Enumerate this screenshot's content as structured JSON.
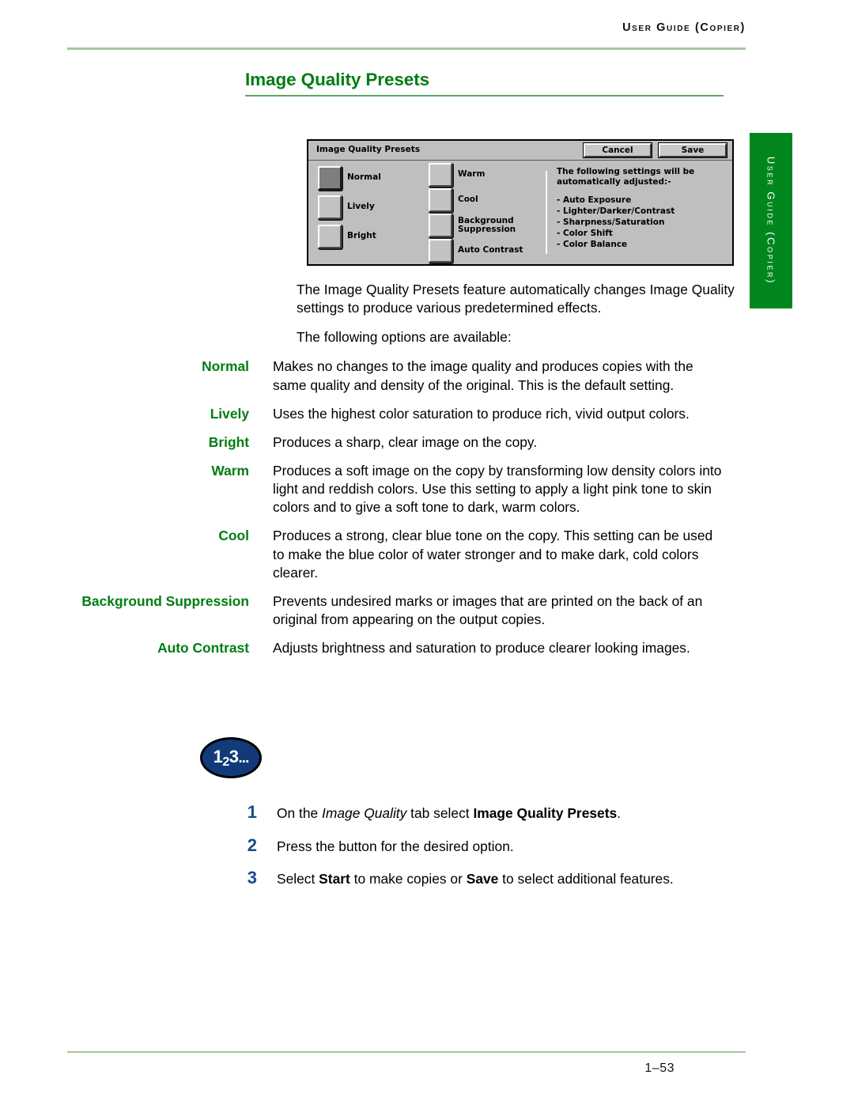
{
  "header": {
    "running_head": "User Guide (Copier)",
    "rule_color": "#a8c6a0"
  },
  "page_title": "Image Quality Presets",
  "side_tab": {
    "label": "User Guide (Copier)",
    "background": "#00861c",
    "text_color": "#ffffff"
  },
  "ui_panel": {
    "title": "Image Quality Presets",
    "cancel_label": "Cancel",
    "save_label": "Save",
    "left_options": [
      {
        "label": "Normal",
        "selected": true
      },
      {
        "label": "Lively",
        "selected": false
      },
      {
        "label": "Bright",
        "selected": false
      }
    ],
    "mid_options": [
      {
        "label": "Warm",
        "selected": false
      },
      {
        "label": "Cool",
        "selected": false
      },
      {
        "label": "Background\nSuppression",
        "selected": false
      },
      {
        "label": "Auto Contrast",
        "selected": false
      }
    ],
    "info_heading": "The following settings will be\nautomatically adjusted:-",
    "info_items": [
      "- Auto Exposure",
      "- Lighter/Darker/Contrast",
      "- Sharpness/Saturation",
      "- Color Shift",
      "- Color Balance"
    ]
  },
  "body": {
    "intro_1": "The Image Quality Presets feature automatically changes Image Quality settings to produce various predetermined effects.",
    "intro_2": "The following options are available:",
    "definitions": [
      {
        "term": "Normal",
        "description": "Makes no changes to the image quality and produces copies with the same quality and density of the original.  This is the default setting."
      },
      {
        "term": "Lively",
        "description": "Uses the highest color saturation to produce rich, vivid output colors."
      },
      {
        "term": "Bright",
        "description": "Produces a sharp, clear image on the copy."
      },
      {
        "term": "Warm",
        "description": "Produces a soft image on the copy by transforming low density colors into light and reddish colors.  Use this setting to apply a light pink tone to skin colors and to give a soft tone to dark, warm colors."
      },
      {
        "term": "Cool",
        "description": "Produces a strong, clear blue tone on the copy.  This setting can be used to make the blue color of water stronger and to make dark, cold colors clearer."
      },
      {
        "term": "Background Suppression",
        "description": "Prevents undesired marks or images that are printed on the back of an original from appearing on the output copies."
      },
      {
        "term": "Auto Contrast",
        "description": "Adjusts brightness and saturation to produce clearer looking images."
      }
    ]
  },
  "steps_badge": {
    "first": "1",
    "second": "2",
    "third": "3",
    "dots": "...",
    "fill_color": "#123a7a"
  },
  "steps": [
    {
      "number": "1",
      "text_parts": [
        {
          "text": "On the ",
          "style": "normal"
        },
        {
          "text": "Image Quality",
          "style": "italic"
        },
        {
          "text": " tab select ",
          "style": "normal"
        },
        {
          "text": "Image Quality Presets",
          "style": "bold"
        },
        {
          "text": ".",
          "style": "normal"
        }
      ]
    },
    {
      "number": "2",
      "text_parts": [
        {
          "text": "Press the button for the desired option.",
          "style": "normal"
        }
      ]
    },
    {
      "number": "3",
      "text_parts": [
        {
          "text": "Select ",
          "style": "normal"
        },
        {
          "text": "Start",
          "style": "bold"
        },
        {
          "text": " to make copies or ",
          "style": "normal"
        },
        {
          "text": "Save",
          "style": "bold"
        },
        {
          "text": " to select additional features.",
          "style": "normal"
        }
      ]
    }
  ],
  "footer": {
    "page_number": "1–53"
  },
  "colors": {
    "heading_green": "#007d12",
    "rule_green": "#5aa860",
    "tab_green": "#00861c",
    "step_blue": "#1a4a8a"
  }
}
